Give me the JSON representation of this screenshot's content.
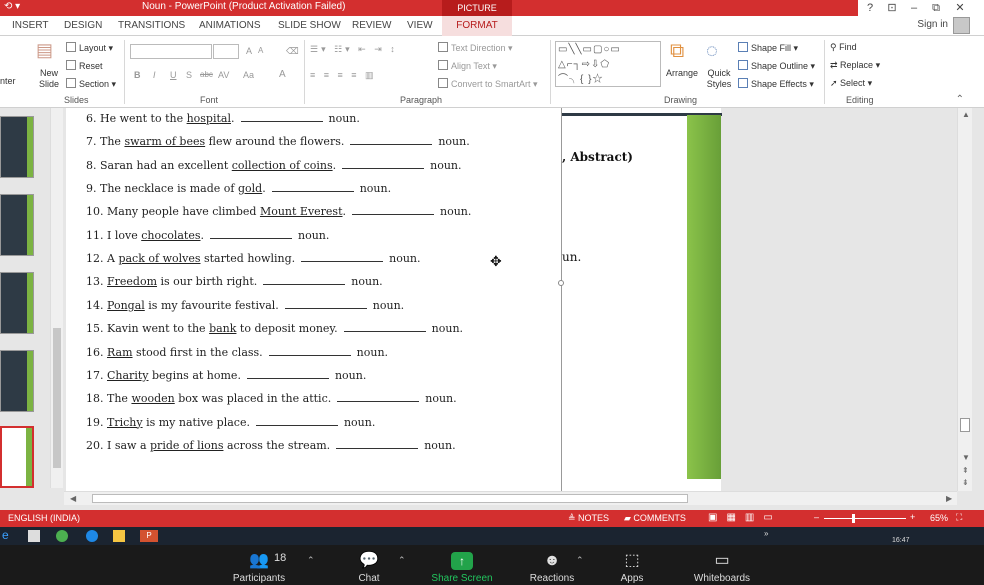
{
  "window": {
    "title": "Noun -  PowerPoint (Product Activation Failed)",
    "picture_tools": "PICTURE TOOLS",
    "controls": {
      "help": "?",
      "restore": "⊡",
      "minimize": "–",
      "maximize": "⧉",
      "close": "✕"
    }
  },
  "tabs": [
    "INSERT",
    "DESIGN",
    "TRANSITIONS",
    "ANIMATIONS",
    "SLIDE SHOW",
    "REVIEW",
    "VIEW",
    "FORMAT"
  ],
  "signin": "Sign in",
  "ribbon": {
    "slides": {
      "new_slide": "New Slide",
      "layout": "Layout",
      "reset": "Reset",
      "section": "Section",
      "label": "Slides",
      "enter_partial": "nter"
    },
    "font": {
      "label": "Font",
      "bold": "B",
      "italic": "I",
      "underline": "U",
      "shadow": "S",
      "strike": "abc",
      "spacing": "AV",
      "case": "Aa",
      "color": "A",
      "grow": "A",
      "shrink": "A"
    },
    "paragraph": {
      "label": "Paragraph",
      "text_direction": "Text Direction",
      "align_text": "Align Text",
      "convert_smartart": "Convert to SmartArt"
    },
    "drawing": {
      "label": "Drawing",
      "arrange": "Arrange",
      "quick_styles": "Quick Styles",
      "shape_fill": "Shape Fill",
      "shape_outline": "Shape Outline",
      "shape_effects": "Shape Effects"
    },
    "editing": {
      "label": "Editing",
      "find": "Find",
      "replace": "Replace",
      "select": "Select"
    }
  },
  "slide": {
    "lines": [
      {
        "num": "6.",
        "pre": "He went to the ",
        "u": "hospital",
        "post": ".",
        "suffix": "noun."
      },
      {
        "num": "7.",
        "pre": "The ",
        "u": "swarm of bees",
        "post": " flew around the flowers.",
        "suffix": "noun."
      },
      {
        "num": "8.",
        "pre": "Saran had an excellent ",
        "u": "collection of coins",
        "post": ".",
        "suffix": "noun."
      },
      {
        "num": "9.",
        "pre": "The necklace is made of ",
        "u": "gold",
        "post": ".",
        "suffix": "noun."
      },
      {
        "num": "10.",
        "pre": "Many people have climbed ",
        "u": "Mount Everest",
        "post": ".",
        "suffix": "noun."
      },
      {
        "num": "11.",
        "pre": "I love ",
        "u": "chocolates",
        "post": ".",
        "suffix": "noun."
      },
      {
        "num": "12.",
        "pre": "A ",
        "u": "pack of wolves",
        "post": " started howling.",
        "suffix": "noun."
      },
      {
        "num": "13.",
        "pre": "",
        "u": "Freedom",
        "post": " is our birth right.",
        "suffix": "noun."
      },
      {
        "num": "14.",
        "pre": "",
        "u": "Pongal",
        "post": " is my favourite festival.",
        "suffix": "noun."
      },
      {
        "num": "15.",
        "pre": "Kavin went to the ",
        "u": "bank",
        "post": " to deposit money.",
        "suffix": "noun."
      },
      {
        "num": "16.",
        "pre": "",
        "u": "Ram",
        "post": " stood first in the class.",
        "suffix": "noun."
      },
      {
        "num": "17.",
        "pre": "",
        "u": "Charity",
        "post": " begins at home.",
        "suffix": "noun."
      },
      {
        "num": "18.",
        "pre": "The ",
        "u": "wooden",
        "post": " box was placed in the attic.",
        "suffix": "noun."
      },
      {
        "num": "19.",
        "pre": "",
        "u": "Trichy",
        "post": " is my native place.",
        "suffix": "noun."
      },
      {
        "num": "20.",
        "pre": "I saw a ",
        "u": "pride of lions",
        "post": " across the stream.",
        "suffix": "noun."
      }
    ],
    "behind_text_1": ", Abstract)",
    "behind_text_2": "un."
  },
  "status": {
    "language": "ENGLISH (INDIA)",
    "notes": "NOTES",
    "comments": "COMMENTS",
    "zoom": "65%"
  },
  "taskbar": {
    "clock": "16:47"
  },
  "meeting": {
    "participants": {
      "label": "Participants",
      "count": "18"
    },
    "chat": "Chat",
    "share": "Share Screen",
    "reactions": "Reactions",
    "apps": "Apps",
    "whiteboards": "Whiteboards"
  },
  "colors": {
    "accent": "#d32f2f",
    "slide_green": "#8bc34a",
    "share_green": "#22a34a"
  }
}
